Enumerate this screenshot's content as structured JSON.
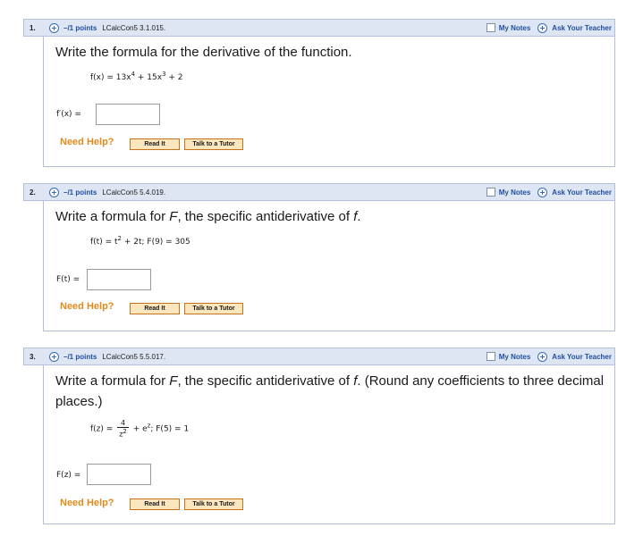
{
  "header_labels": {
    "my_notes": "My Notes",
    "ask_teacher": "Ask Your Teacher"
  },
  "help": {
    "need_help": "Need Help?",
    "read_it": "Read It",
    "talk_tutor": "Talk to a Tutor"
  },
  "questions": [
    {
      "number": "1.",
      "points": "–/1 points",
      "ref": "LCalcCon5 3.1.015.",
      "prompt": "Write the formula for the derivative of the function.",
      "answer_label": "f′(x) ="
    },
    {
      "number": "2.",
      "points": "–/1 points",
      "ref": "LCalcCon5 5.4.019.",
      "prompt_part1": "Write a formula for ",
      "prompt_F": "F",
      "prompt_part2": ", the specific antiderivative of ",
      "prompt_f": "f",
      "prompt_part3": ".",
      "answer_label": "F(t) ="
    },
    {
      "number": "3.",
      "points": "–/1 points",
      "ref": "LCalcCon5 5.5.017.",
      "prompt_part1": "Write a formula for ",
      "prompt_F": "F",
      "prompt_part2": ", the specific antiderivative of ",
      "prompt_f": "f",
      "prompt_part3": ". (Round any coefficients to three decimal places.)",
      "answer_label": "F(z) ="
    }
  ],
  "formula1": {
    "lhs": "f(x) = 13x",
    "exp1": "4",
    "mid": " + 15x",
    "exp2": "3",
    "tail": " + 2"
  },
  "formula2": {
    "lhs": "f(t) = t",
    "exp1": "2",
    "tail": " + 2t; F(9) = 305"
  },
  "formula3": {
    "lhs": "f(z) = ",
    "num": "4",
    "den": "z",
    "den_exp": "2",
    "mid": " + e",
    "exp": "z",
    "tail": "; F(5) = 1"
  }
}
